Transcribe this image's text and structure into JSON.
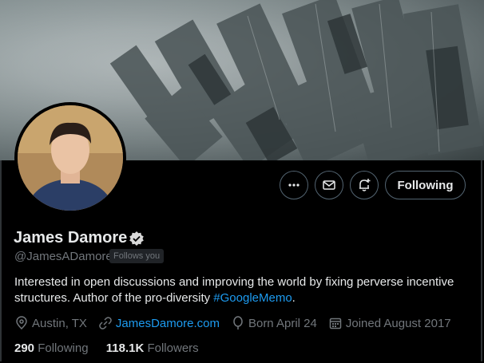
{
  "profile": {
    "name": "James Damore",
    "handle": "@JamesADamore",
    "follows_you": "Follows you",
    "bio_text": "Interested in open discussions and improving the world by fixing perverse incentive structures. Author of the pro-diversity ",
    "bio_hashtag": "#GoogleMemo",
    "bio_end": ".",
    "location": "Austin, TX",
    "website": "JamesDamore.com",
    "birthday": "Born April 24",
    "joined": "Joined August 2017",
    "following_count": "290",
    "following_label": "Following",
    "followers_count": "118.1K",
    "followers_label": "Followers"
  },
  "actions": {
    "following_button": "Following",
    "more_icon": "more-icon",
    "message_icon": "envelope-icon",
    "notify_icon": "bell-plus-icon"
  },
  "colors": {
    "background": "#000000",
    "accent": "#1d9bf0",
    "secondary_text": "#71767b"
  }
}
